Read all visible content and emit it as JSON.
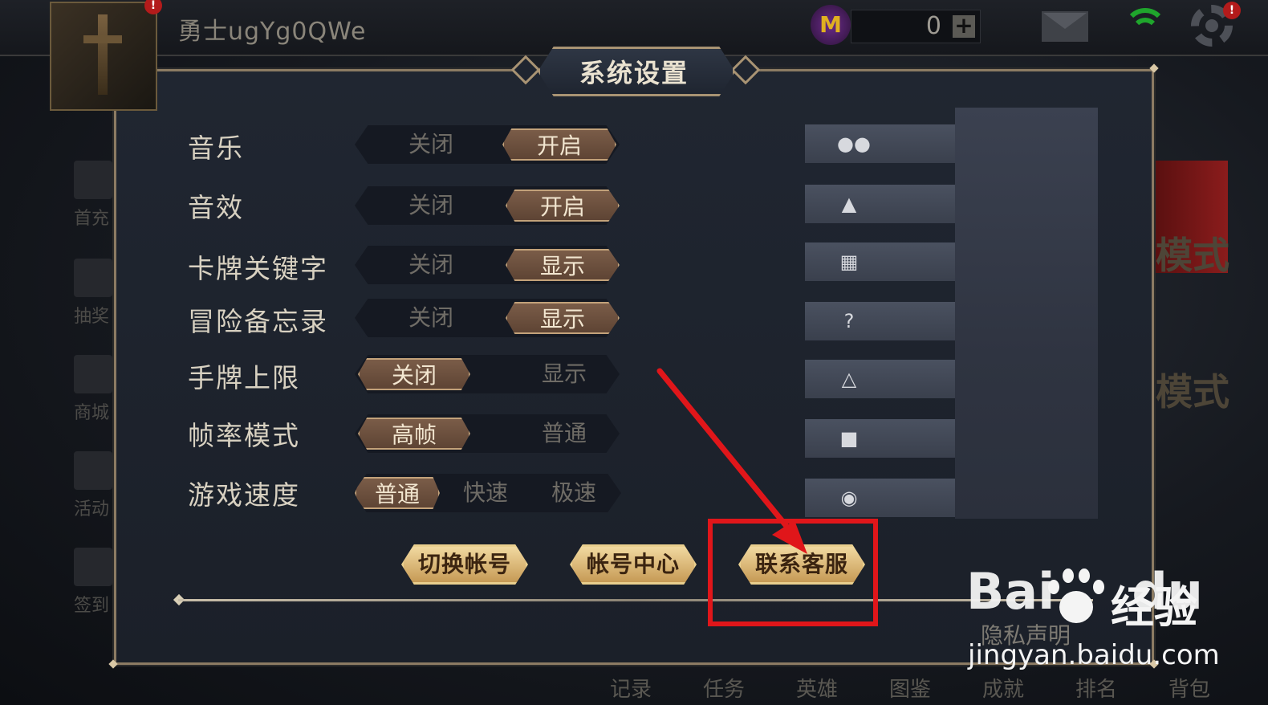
{
  "topbar": {
    "username": "勇士ugYg0QWe",
    "currency_icon": "M",
    "currency_value": "0",
    "plus_icon": "+",
    "avatar_badge": "!",
    "settings_badge": "!"
  },
  "sidebar": {
    "items": [
      {
        "label": "首充",
        "icon": "gift-icon"
      },
      {
        "label": "抽奖",
        "icon": "lottery-icon"
      },
      {
        "label": "商城",
        "icon": "cart-icon"
      },
      {
        "label": "活动",
        "icon": "event-icon"
      },
      {
        "label": "签到",
        "icon": "calendar-icon"
      }
    ]
  },
  "bottom_nav": [
    "记录",
    "任务",
    "英雄",
    "图鉴",
    "成就",
    "排名",
    "背包"
  ],
  "background_text": [
    "模式",
    "模式"
  ],
  "dialog": {
    "title": "系统设置",
    "rows": [
      {
        "label": "音乐",
        "options": [
          "关闭",
          "开启"
        ],
        "selected": "开启"
      },
      {
        "label": "音效",
        "options": [
          "关闭",
          "开启"
        ],
        "selected": "开启"
      },
      {
        "label": "卡牌关键字",
        "options": [
          "关闭",
          "显示"
        ],
        "selected": "显示"
      },
      {
        "label": "冒险备忘录",
        "options": [
          "关闭",
          "显示"
        ],
        "selected": "显示"
      },
      {
        "label": "手牌上限",
        "options": [
          "关闭",
          "显示"
        ],
        "selected": "关闭"
      },
      {
        "label": "帧率模式",
        "options": [
          "高帧",
          "普通"
        ],
        "selected": "高帧"
      },
      {
        "label": "游戏速度",
        "options": [
          "普通",
          "快速",
          "极速"
        ],
        "selected": "普通"
      }
    ],
    "side_buttons": [
      "wechat-icon",
      "qq-icon",
      "qrcode-icon",
      "help-icon",
      "bell-icon",
      "video-icon",
      "helmet-icon"
    ],
    "actions": {
      "switch_account": "切换帐号",
      "account_center": "帐号中心",
      "contact_service": "联系客服"
    },
    "privacy": "隐私声明"
  },
  "watermark": {
    "logo": "Bai",
    "logo_tail": "du",
    "cn": "经验",
    "url": "jingyan.baidu.com"
  },
  "colors": {
    "accent_gold": "#e9cf8e",
    "highlight_red": "#e0161a",
    "active_toggle": "#7a5c48",
    "panel_bg": "#1d222b"
  }
}
